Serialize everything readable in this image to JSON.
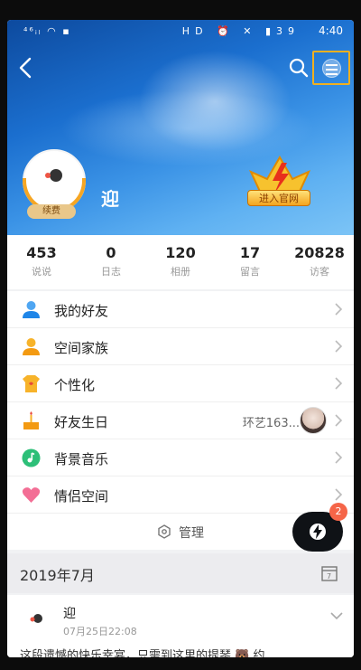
{
  "status_bar": {
    "carrier": "⁴⁶ᵢₗ ◠ ▪",
    "icons": "HD ⏰ ✕ ▮39",
    "time": "4:40"
  },
  "profile": {
    "nickname": "迎",
    "badge": "续费",
    "vip_label": "进入官网"
  },
  "stats": [
    {
      "value": "453",
      "label": "说说"
    },
    {
      "value": "0",
      "label": "日志"
    },
    {
      "value": "120",
      "label": "相册"
    },
    {
      "value": "17",
      "label": "留言"
    },
    {
      "value": "20828",
      "label": "访客"
    }
  ],
  "menu": [
    {
      "label": "我的好友",
      "icon": "friends-icon"
    },
    {
      "label": "空间家族",
      "icon": "family-icon"
    },
    {
      "label": "个性化",
      "icon": "personalize-icon"
    },
    {
      "label": "好友生日",
      "icon": "birthday-icon",
      "extra": "环艺163..."
    },
    {
      "label": "背景音乐",
      "icon": "music-icon"
    },
    {
      "label": "情侣空间",
      "icon": "heart-icon"
    }
  ],
  "manage": {
    "label": "管理"
  },
  "fab": {
    "count": "2"
  },
  "timeline": {
    "date": "2019年7月"
  },
  "feed": {
    "name": "迎",
    "time": "07月25日22:08",
    "snippet": "这段遗憾的快乐幸宴，只需到这里的提琴 🐻 约"
  },
  "colors": {
    "accent": "#f6a623",
    "highlight": "#f0b020",
    "fab": "#0f1216",
    "badge_red": "#f56548"
  }
}
